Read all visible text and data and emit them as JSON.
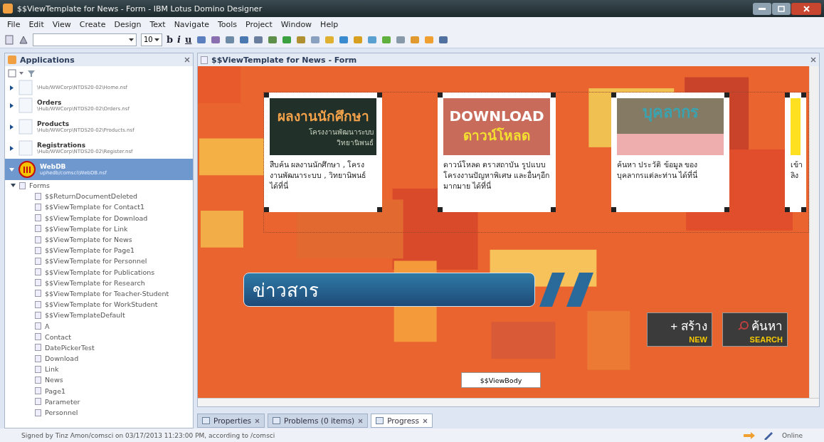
{
  "window": {
    "title": "$$ViewTemplate for News - Form - IBM Lotus Domino Designer"
  },
  "menu": [
    "File",
    "Edit",
    "View",
    "Create",
    "Design",
    "Text",
    "Navigate",
    "Tools",
    "Project",
    "Window",
    "Help"
  ],
  "toolbar": {
    "font_size": "10",
    "bold": "b",
    "italic": "i",
    "underline": "u"
  },
  "applications": {
    "title": "Applications",
    "items": [
      {
        "path": "\\Hub/WWCorp\\NTDS20-02\\Home.nsf",
        "selected": false,
        "expanded": false
      },
      {
        "name": "Orders",
        "path": "\\Hub/WWCorp\\NTDS20-02\\Orders.nsf",
        "selected": false,
        "expanded": false
      },
      {
        "name": "Products",
        "path": "\\Hub/WWCorp\\NTDS20-02\\Products.nsf",
        "selected": false,
        "expanded": false
      },
      {
        "name": "Registrations",
        "path": "\\Hub/WWCorp\\NTDS20-02\\Register.nsf",
        "selected": false,
        "expanded": false
      },
      {
        "name": "WebDB",
        "path": "uphedb/comsci\\WebDB.nsf",
        "selected": true,
        "expanded": true
      }
    ],
    "tree": {
      "label": "Forms",
      "expanded": true,
      "children": [
        {
          "label": "$$ReturnDocumentDeleted"
        },
        {
          "label": "$$ViewTemplate for Contact1"
        },
        {
          "label": "$$ViewTemplate for Download"
        },
        {
          "label": "$$ViewTemplate for Link"
        },
        {
          "label": "$$ViewTemplate for News"
        },
        {
          "label": "$$ViewTemplate for Page1"
        },
        {
          "label": "$$ViewTemplate for Personnel"
        },
        {
          "label": "$$ViewTemplate for Publications"
        },
        {
          "label": "$$ViewTemplate for Research"
        },
        {
          "label": "$$ViewTemplate for Teacher-Student"
        },
        {
          "label": "$$ViewTemplate for WorkStudent"
        },
        {
          "label": "$$ViewTemplateDefault"
        },
        {
          "label": "A"
        },
        {
          "label": "Contact"
        },
        {
          "label": "DatePickerTest"
        },
        {
          "label": "Download"
        },
        {
          "label": "Link"
        },
        {
          "label": "News"
        },
        {
          "label": "Page1"
        },
        {
          "label": "Parameter"
        },
        {
          "label": "Personnel"
        }
      ]
    }
  },
  "editor": {
    "title": "$$ViewTemplate for News - Form",
    "cards": [
      {
        "kind": "works",
        "heading": "ผลงานนักศึกษา",
        "subheading": "โครงงานพัฒนาระบบ",
        "subheading_2": "วิทยานิพนธ์",
        "description": "สืบค้น ผลงานนักศึกษา , โครงงานพัฒนาระบบ , วิทยานิพนธ์ ได้ที่นี่"
      },
      {
        "kind": "download",
        "heading": "DOWNLOAD",
        "subheading": "ดาวน์โหลด",
        "description": "ดาวน์โหลด ตราสถาบัน รูปแบบโครงงานปัญหาพิเศษ และอื่นๆอีกมากมาย ได้ที่นี่"
      },
      {
        "kind": "personnel",
        "heading": "บุคลากร",
        "description": "ค้นหา ประวัติ ข้อมูล ของ บุคลากรแต่ละท่าน ได้ที่นี่"
      },
      {
        "kind": "partial",
        "description": "เข้า ลิง"
      }
    ],
    "banner": "ข่าวสาร",
    "buttons": [
      {
        "kind": "new",
        "label": "+ สร้าง",
        "caption": "NEW"
      },
      {
        "kind": "search",
        "label": "ค้นหา",
        "caption": "SEARCH"
      }
    ],
    "field": "$$ViewBody"
  },
  "bottom_tabs": [
    {
      "label": "Properties",
      "selected": false
    },
    {
      "label": "Problems (0 items)",
      "selected": false
    },
    {
      "label": "Progress",
      "selected": true
    }
  ],
  "status_bar": {
    "text": "Signed by Tinz Amon/comsci on 03/17/2013 11:23:00 PM, according to /comsci",
    "online": "Online"
  }
}
